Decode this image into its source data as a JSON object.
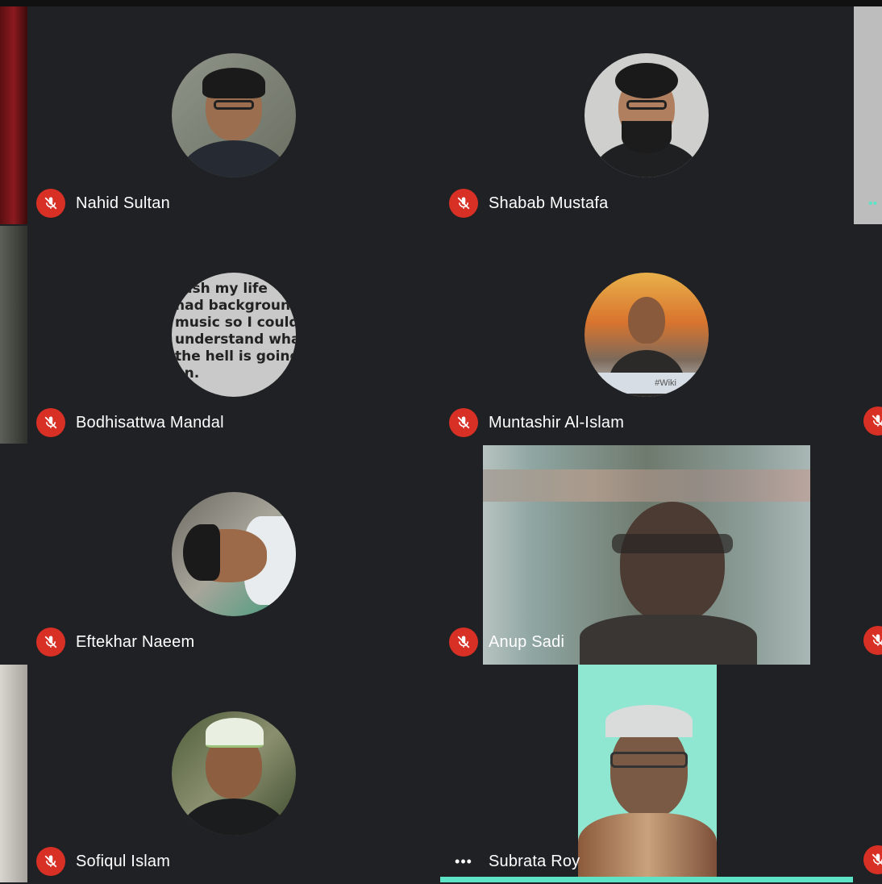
{
  "participants": [
    {
      "name": "Nahid Sultan",
      "muted": true
    },
    {
      "name": "Shabab Mustafa",
      "muted": true
    },
    {
      "name": "Bodhisattwa Mandal",
      "muted": true
    },
    {
      "name": "Muntashir Al-Islam",
      "muted": true
    },
    {
      "name": "Eftekhar Naeem",
      "muted": true
    },
    {
      "name": "Anup Sadi",
      "muted": true
    },
    {
      "name": "Sofiqul Islam",
      "muted": true
    },
    {
      "name": "Subrata Roy",
      "muted": false,
      "speaking": true
    }
  ],
  "quote_avatar_text": "wish my life\nhad background\nmusic so I could\nunderstand what\nthe hell is going\non.",
  "wikipedia_sign": "#Wiki",
  "icons": {
    "mic_off": "mic-off-icon",
    "more": "more-options-icon"
  },
  "colors": {
    "background": "#202124",
    "mic_off_badge": "#d93025",
    "active_speaker": "#5de4c7"
  }
}
